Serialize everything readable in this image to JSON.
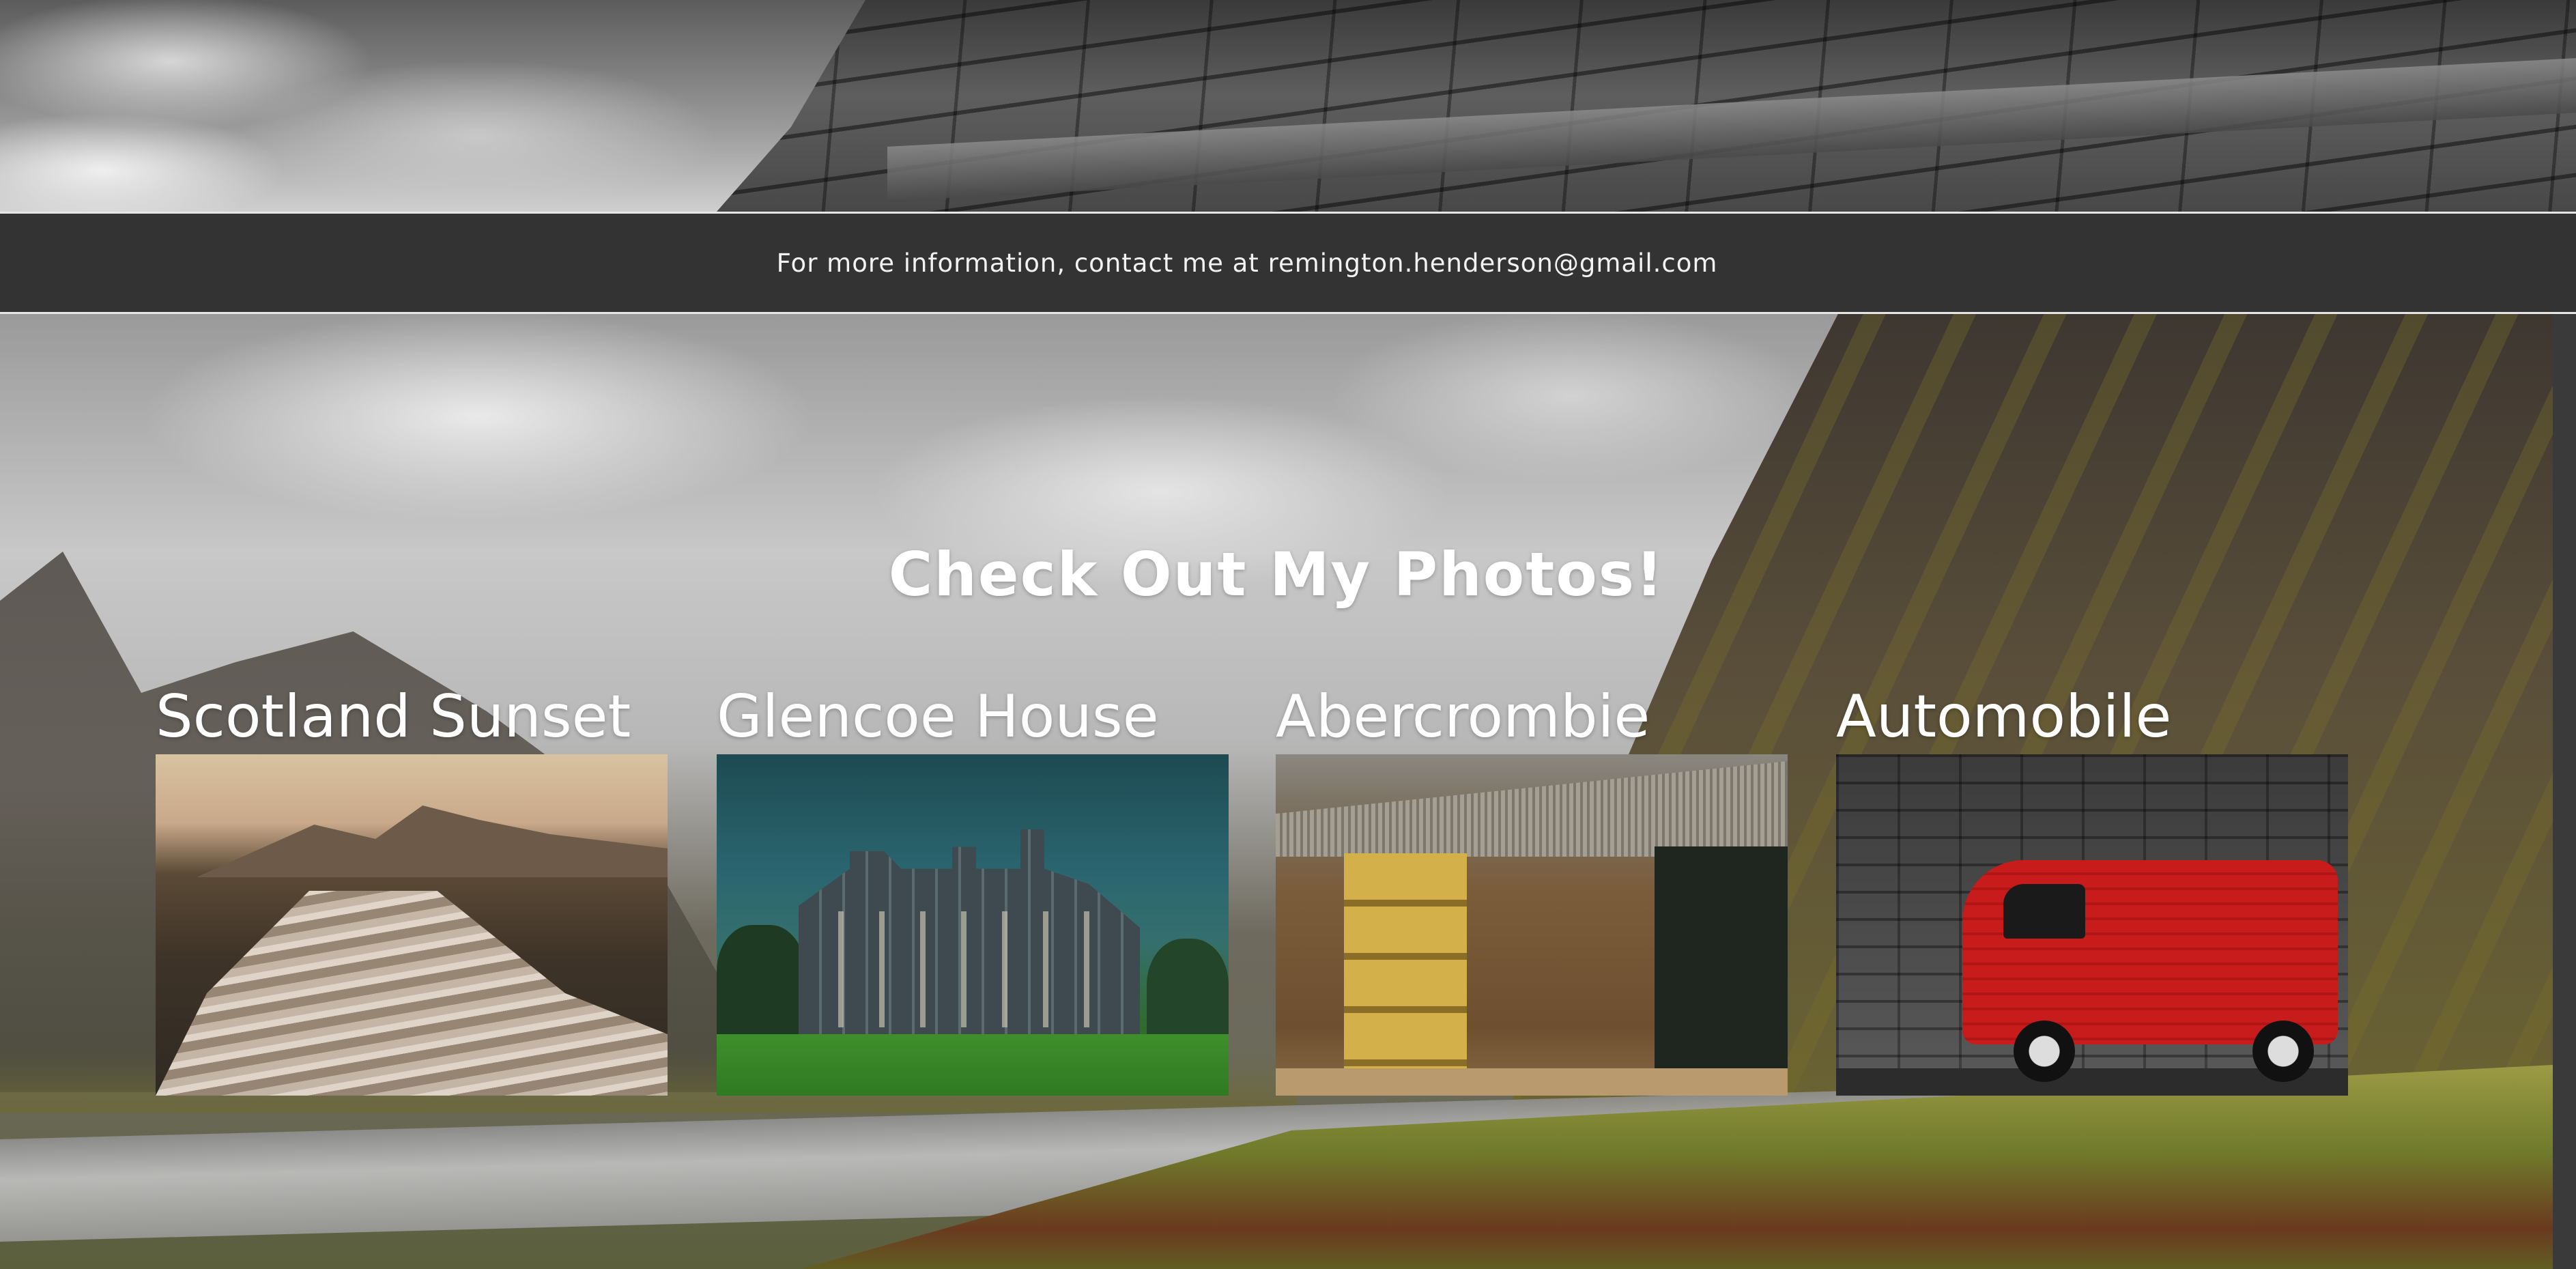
{
  "contact": {
    "text": "For more information, contact me at remington.henderson@gmail.com"
  },
  "gallery": {
    "title": "Check Out My Photos!",
    "photos": [
      {
        "caption": "Scotland Sunset"
      },
      {
        "caption": "Glencoe House"
      },
      {
        "caption": "Abercrombie"
      },
      {
        "caption": "Automobile"
      }
    ]
  },
  "colors": {
    "contact_bar_bg": "#333333",
    "text": "#ffffff",
    "divider": "#e6e6e6"
  }
}
